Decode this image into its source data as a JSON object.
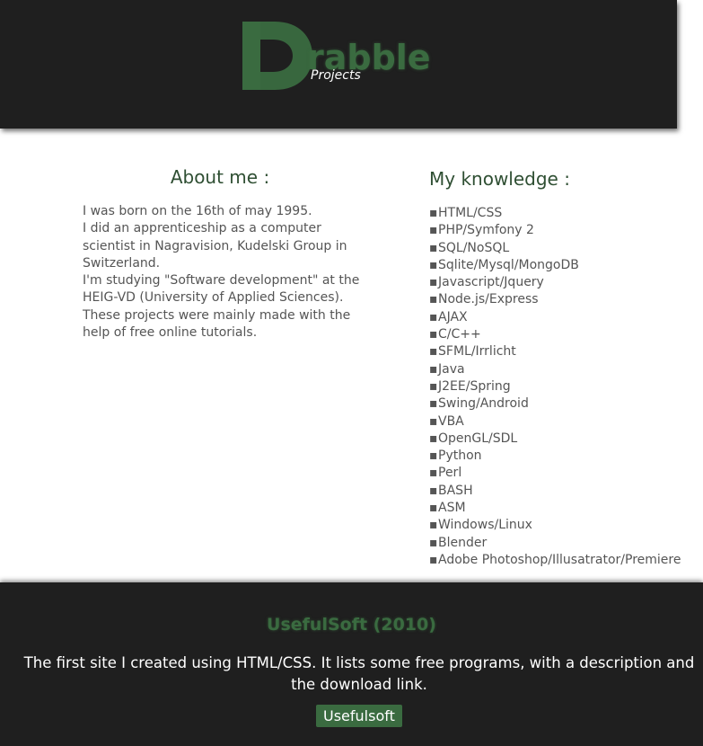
{
  "header": {
    "logo_letter": "D",
    "logo_rest": "rabble",
    "logo_subtitle": "Projects"
  },
  "about": {
    "title": "About me :",
    "lines": [
      "I was born on the 16th of may 1995.",
      "I did an apprenticeship as a computer scientist in Nagravision, Kudelski Group in Switzerland.",
      "I'm studying \"Software development\" at the HEIG-VD (University of Applied Sciences). These projects were mainly made with the help of free online tutorials."
    ]
  },
  "knowledge": {
    "title": "My knowledge :",
    "items": [
      "HTML/CSS",
      "PHP/Symfony 2",
      "SQL/NoSQL",
      "Sqlite/Mysql/MongoDB",
      "Javascript/Jquery",
      "Node.js/Express",
      "AJAX",
      "C/C++",
      "SFML/Irrlicht",
      "Java",
      "J2EE/Spring",
      "Swing/Android",
      "VBA",
      "OpenGL/SDL",
      "Python",
      "Perl",
      "BASH",
      "ASM",
      "Windows/Linux",
      "Blender",
      "Adobe Photoshop/Illusatrator/Premiere"
    ]
  },
  "project": {
    "title": "UsefulSoft (2010)",
    "description": "The first site I created using HTML/CSS. It lists some free programs, with a description and the download link.",
    "button_label": "Usefulsoft"
  },
  "colors": {
    "header_bg": "#1f1f1f",
    "accent_green": "#3a6b40",
    "heading_green": "#2f4f33",
    "body_text": "#555555"
  }
}
